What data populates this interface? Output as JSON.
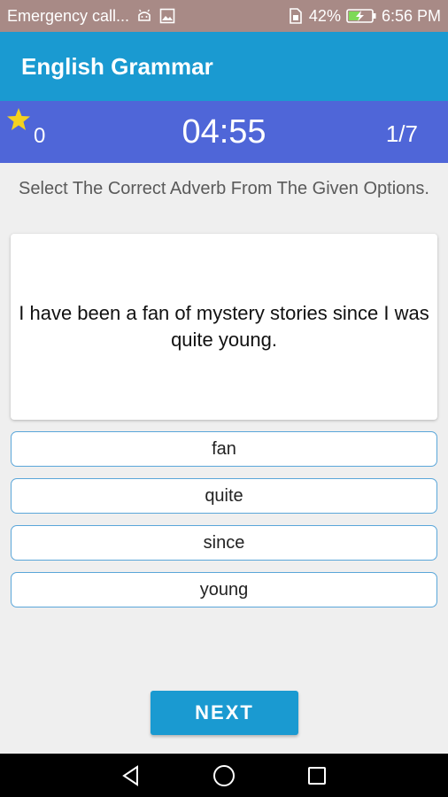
{
  "status_bar": {
    "left_text": "Emergency call...",
    "battery_percent": "42%",
    "time": "6:56 PM",
    "icons": [
      "android-icon",
      "image-icon",
      "sim-icon",
      "battery-charging-icon"
    ]
  },
  "app_bar": {
    "title": "English Grammar"
  },
  "score_bar": {
    "star_icon": "star-icon",
    "score": "0",
    "timer": "04:55",
    "progress": "1/7"
  },
  "instruction": "Select The Correct Adverb From The Given Options.",
  "question": {
    "text": "I have been a fan of mystery stories since I was quite young."
  },
  "options": [
    {
      "label": "fan"
    },
    {
      "label": "quite"
    },
    {
      "label": "since"
    },
    {
      "label": "young"
    }
  ],
  "next_button": {
    "label": "NEXT"
  },
  "nav_bar": {
    "icons": [
      "back-icon",
      "home-icon",
      "recents-icon"
    ]
  },
  "colors": {
    "status_bar": "#a88a86",
    "app_bar": "#1a9ad1",
    "score_bar": "#4f66d8",
    "background": "#efefef",
    "option_border": "#5aa6d9",
    "star": "#f4d21f"
  }
}
